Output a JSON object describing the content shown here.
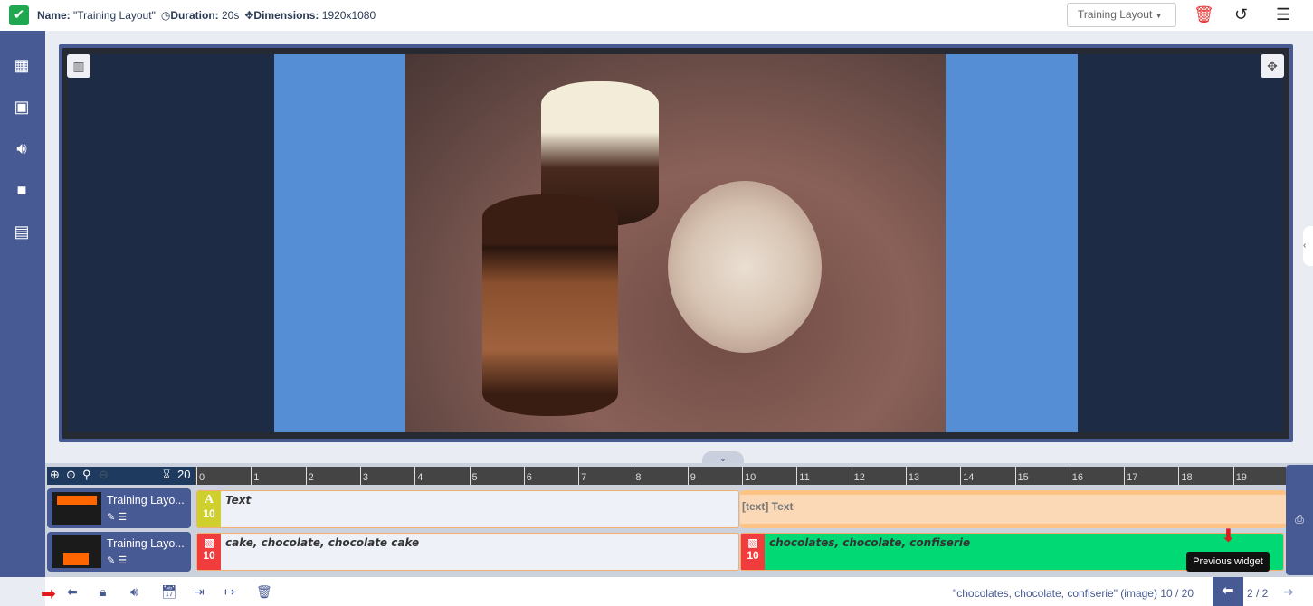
{
  "header": {
    "name_label": "Name:",
    "name_value": "\"Training Layout\"",
    "duration_label": "Duration:",
    "duration_value": "20s",
    "dimensions_label": "Dimensions:",
    "dimensions_value": "1920x1080",
    "layout_select": "Training Layout"
  },
  "sidebar": {
    "items": [
      "layout",
      "image",
      "audio",
      "video",
      "archive"
    ]
  },
  "timeline": {
    "total": "20",
    "ruler": [
      "0",
      "1",
      "2",
      "3",
      "4",
      "5",
      "6",
      "7",
      "8",
      "9",
      "10",
      "11",
      "12",
      "13",
      "14",
      "15",
      "16",
      "17",
      "18",
      "19"
    ],
    "regions": [
      {
        "name": "Training Layo...",
        "widgets": [
          {
            "label": "Text",
            "badge": "A",
            "duration": "10",
            "color": "#cfcf2e"
          },
          {
            "label": "[text] Text"
          }
        ]
      },
      {
        "name": "Training Layo...",
        "widgets": [
          {
            "label": "cake, chocolate, chocolate cake",
            "duration": "10",
            "color": "#f03c3c"
          },
          {
            "label": "chocolates, chocolate, confiserie",
            "duration": "10",
            "color": "#f03c3c"
          }
        ]
      }
    ]
  },
  "footer": {
    "status": "\"chocolates, chocolate, confiserie\" (image) 10 / 20",
    "page": "2 / 2",
    "tooltip": "Previous widget"
  }
}
